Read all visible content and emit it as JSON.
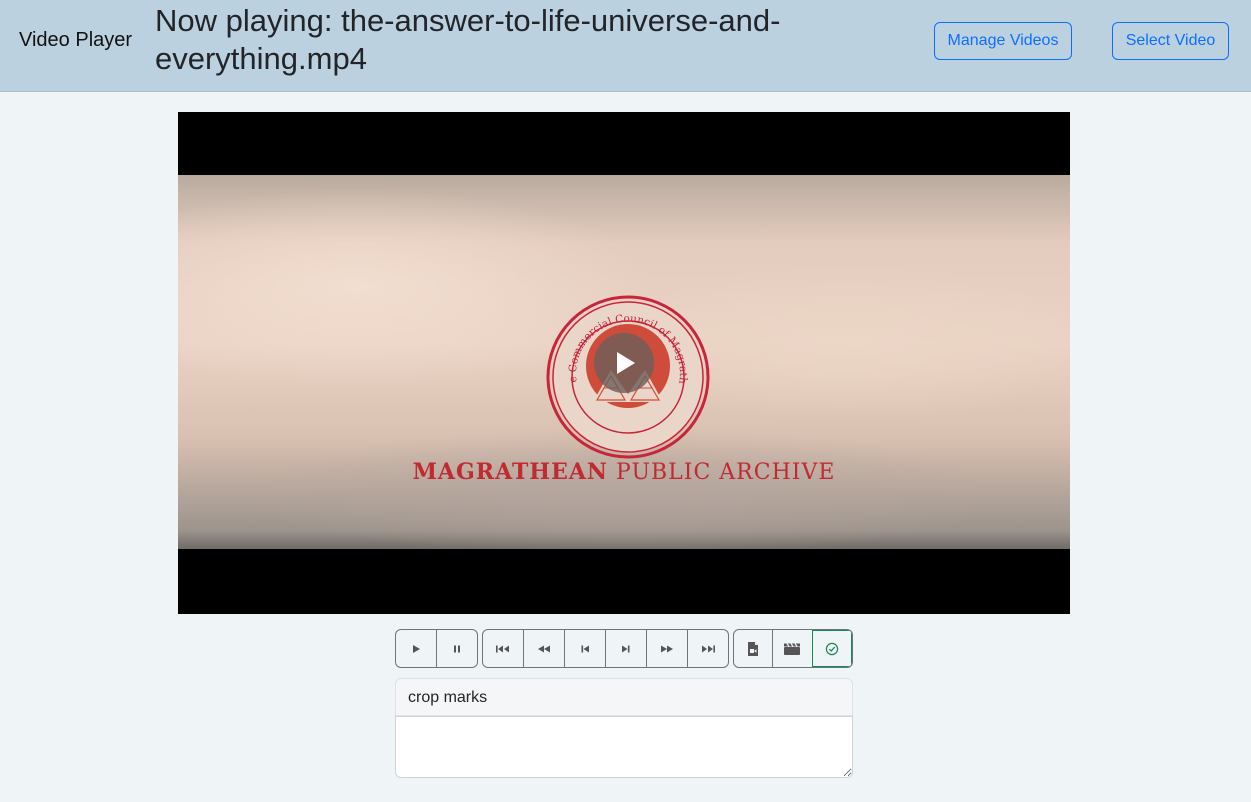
{
  "header": {
    "brand": "Video Player",
    "now_playing": "Now playing: the-answer-to-life-universe-and-everything.mp4",
    "manage_videos_label": "Manage Videos",
    "select_video_label": "Select Video"
  },
  "video": {
    "emblem_text": "The Commercial Council of Magrathea",
    "title_bold": "MAGRATHEAN",
    "title_regular": "PUBLIC ARCHIVE",
    "play_overlay_icon": "play-icon"
  },
  "controls": {
    "playback": [
      "play-icon",
      "pause-icon"
    ],
    "seek": [
      "skip-start-icon",
      "rewind-icon",
      "step-back-icon",
      "step-forward-icon",
      "fast-forward-icon",
      "skip-end-icon"
    ],
    "tools": [
      "file-video-icon",
      "clapperboard-icon",
      "check-circle-icon"
    ]
  },
  "annotation": {
    "label": "crop marks",
    "notes_value": "",
    "notes_placeholder": ""
  },
  "colors": {
    "header_bg": "#bcd1e0",
    "page_bg": "#eff4f7",
    "primary": "#0d6efd",
    "success": "#198754",
    "archive_red": "#c02a30"
  }
}
